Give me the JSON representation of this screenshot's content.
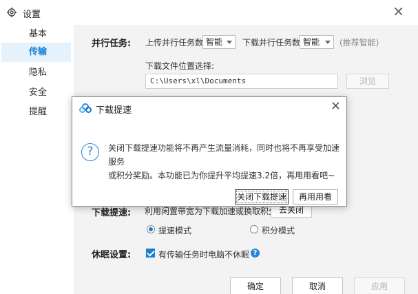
{
  "window": {
    "title": "设置",
    "icon": "gear-icon",
    "close": "×"
  },
  "sidebar": {
    "items": [
      {
        "label": "基本",
        "active": false
      },
      {
        "label": "传输",
        "active": true
      },
      {
        "label": "隐私",
        "active": false
      },
      {
        "label": "安全",
        "active": false
      },
      {
        "label": "提醒",
        "active": false
      }
    ]
  },
  "parallel": {
    "label": "并行任务:",
    "upload_label": "上传并行任务数",
    "upload_value": "智能",
    "download_label": "下载并行任务数",
    "download_value": "智能",
    "hint": "(推荐智能)"
  },
  "download_location": {
    "label": "下载文件位置选择:",
    "path": "C:\\Users\\xl\\Documents",
    "browse": "浏览"
  },
  "speedup": {
    "label": "下载提速:",
    "desc": "利用闲置带宽为下载加速或换取积分",
    "action": "去关闭",
    "modes": [
      {
        "label": "提速模式",
        "checked": true
      },
      {
        "label": "积分模式",
        "checked": false
      }
    ]
  },
  "sleep": {
    "label": "休眠设置:",
    "checkbox": "有传输任务时电脑不休眠",
    "checked": true,
    "help": "?"
  },
  "footer": {
    "ok": "确定",
    "cancel": "取消",
    "apply": "应用"
  },
  "dialog": {
    "title": "下载提速",
    "close": "×",
    "icon": "question-icon",
    "message_line1": "关闭下载提速功能将不再产生流量消耗，同时也将不再享受加速服务",
    "message_line2": "或积分奖励。本功能已为你提升平均提速3.2倍，再用用看吧~",
    "confirm": "关闭下载提速",
    "retry": "再用用看"
  },
  "colors": {
    "accent": "#1a7fd4",
    "sidebar_active_bg": "#e6f2fb",
    "content_bg": "#f3f3f3"
  }
}
